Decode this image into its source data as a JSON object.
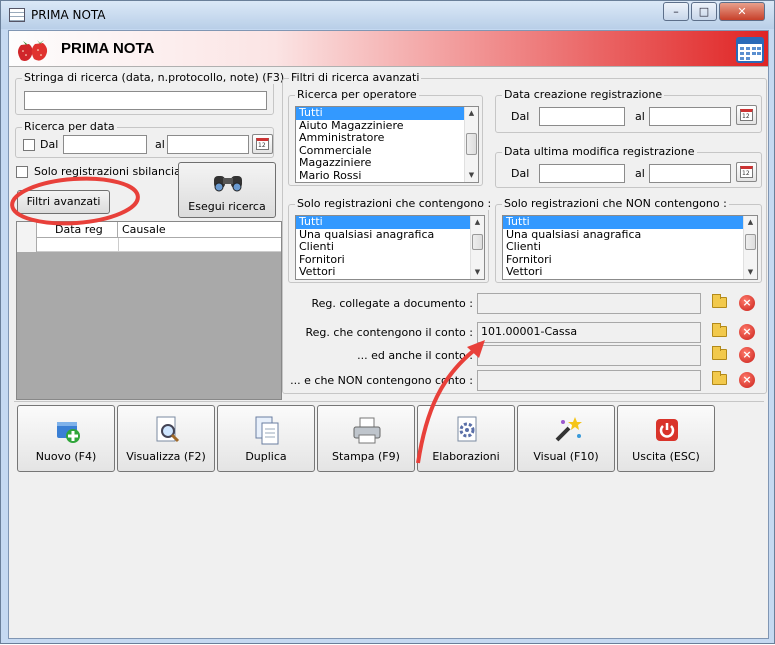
{
  "window": {
    "title": "PRIMA NOTA",
    "controls": {
      "minimize": "–",
      "maximize": "□",
      "close": "✕"
    }
  },
  "header": {
    "title": "PRIMA NOTA",
    "logo_icon": "strawberry-icon",
    "calendar_icon": "calendar-icon"
  },
  "search": {
    "label": "Stringa di ricerca (data, n.protocollo, note) (F3)",
    "value": ""
  },
  "date_search": {
    "label": "Ricerca per data",
    "from_label": "Dal",
    "to_label": "al",
    "from_value": "",
    "to_value": "",
    "checked": false
  },
  "unbalanced": {
    "label": "Solo registrazioni sbilanciate",
    "checked": false
  },
  "advanced_filters_button": "Filtri avanzati",
  "run_search_button": "Esegui ricerca",
  "results_table": {
    "columns": [
      "",
      "Data reg",
      "Causale"
    ],
    "rows": []
  },
  "advanced": {
    "label": "Filtri di ricerca avanzati",
    "operator": {
      "label": "Ricerca per operatore",
      "items": [
        "Tutti",
        "Aiuto Magazziniere",
        "Amministratore",
        "Commerciale",
        "Magazziniere",
        "Mario Rossi"
      ],
      "selected": 0
    },
    "creation_date": {
      "label": "Data creazione registrazione",
      "from_label": "Dal",
      "to_label": "al",
      "from_value": "",
      "to_value": ""
    },
    "modified_date": {
      "label": "Data ultima modifica registrazione",
      "from_label": "Dal",
      "to_label": "al",
      "from_value": "",
      "to_value": ""
    },
    "contains": {
      "label": "Solo registrazioni che contengono :",
      "items": [
        "Tutti",
        "Una qualsiasi anagrafica",
        "Clienti",
        "Fornitori",
        "Vettori"
      ],
      "selected": 0
    },
    "not_contains": {
      "label": "Solo registrazioni che NON contengono :",
      "items": [
        "Tutti",
        "Una qualsiasi anagrafica",
        "Clienti",
        "Fornitori",
        "Vettori"
      ],
      "selected": 0
    },
    "linked_docs": {
      "label": "Reg. collegate a documento :",
      "value": ""
    },
    "account": {
      "label": "Reg. che contengono il conto :",
      "value": "101.00001-Cassa"
    },
    "also_account": {
      "label": "... ed anche il conto :",
      "value": ""
    },
    "not_account": {
      "label": "... e che NON contengono conto :",
      "value": ""
    }
  },
  "toolbar": [
    {
      "label": "Nuovo (F4)",
      "icon": "new-document-icon"
    },
    {
      "label": "Visualizza (F2)",
      "icon": "magnifier-document-icon"
    },
    {
      "label": "Duplica",
      "icon": "duplicate-icon"
    },
    {
      "label": "Stampa (F9)",
      "icon": "printer-icon"
    },
    {
      "label": "Elaborazioni",
      "icon": "gear-document-icon"
    },
    {
      "label": "Visual (F10)",
      "icon": "magic-wand-icon"
    },
    {
      "label": "Uscita (ESC)",
      "icon": "power-icon"
    }
  ],
  "colors": {
    "selection": "#3399ff",
    "annotation": "#e8403a",
    "header_gradient_end": "#e02424"
  }
}
